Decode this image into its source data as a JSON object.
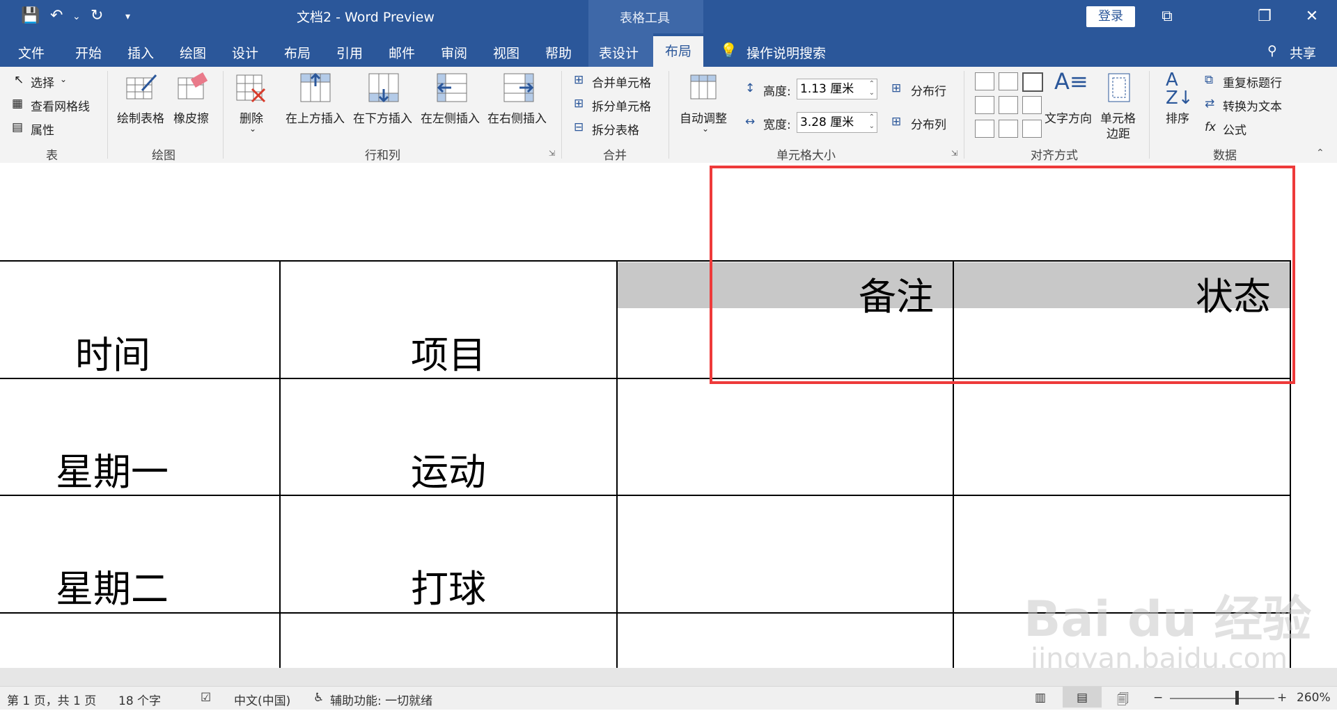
{
  "window": {
    "title": "文档2  -  Word Preview",
    "tools_context": "表格工具",
    "login": "登录",
    "controls": {
      "restore": "⧉",
      "maximize": "❐",
      "close": "✕"
    }
  },
  "menu": {
    "tabs": [
      "文件",
      "开始",
      "插入",
      "绘图",
      "设计",
      "布局",
      "引用",
      "邮件",
      "审阅",
      "视图",
      "帮助",
      "表设计"
    ],
    "active": "布局",
    "search": "操作说明搜索",
    "share": "共享"
  },
  "ribbon": {
    "table": {
      "select": "选择",
      "view_gridlines": "查看网格线",
      "properties": "属性",
      "group": "表"
    },
    "draw": {
      "draw_table": "绘制表格",
      "eraser": "橡皮擦",
      "group": "绘图"
    },
    "rows_cols": {
      "delete": "删除",
      "insert_above": "在上方插入",
      "insert_below": "在下方插入",
      "insert_left": "在左侧插入",
      "insert_right": "在右侧插入",
      "group": "行和列"
    },
    "merge": {
      "merge_cells": "合并单元格",
      "split_cells": "拆分单元格",
      "split_table": "拆分表格",
      "group": "合并"
    },
    "cell_size": {
      "autofit": "自动调整",
      "height_label": "高度:",
      "height_value": "1.13 厘米",
      "width_label": "宽度:",
      "width_value": "3.28 厘米",
      "distribute_rows": "分布行",
      "distribute_cols": "分布列",
      "group": "单元格大小"
    },
    "alignment": {
      "text_direction": "文字方向",
      "cell_margins_1": "单元格",
      "cell_margins_2": "边距",
      "group": "对齐方式"
    },
    "data": {
      "sort": "排序",
      "repeat_header": "重复标题行",
      "convert_text": "转换为文本",
      "formula": "公式",
      "group": "数据"
    }
  },
  "document": {
    "headers": [
      "时间",
      "项目",
      "备注",
      "状态"
    ],
    "rows": [
      [
        "星期一",
        "运动"
      ],
      [
        "星期二",
        "打球"
      ]
    ],
    "watermark_brand": "Bai du 经验",
    "watermark_url": "jingyan.baidu.com"
  },
  "status": {
    "page": "第 1 页，共 1 页",
    "words": "18 个字",
    "language": "中文(中国)",
    "accessibility": "辅助功能: 一切就绪",
    "zoom": "260%"
  }
}
